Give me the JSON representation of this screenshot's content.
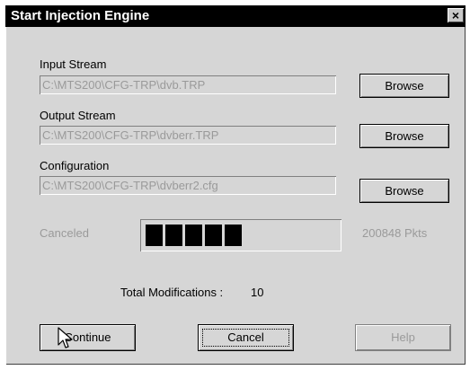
{
  "window": {
    "title": "Start Injection Engine",
    "close_glyph": "×"
  },
  "input_stream": {
    "label": "Input Stream",
    "value": "C:\\MTS200\\CFG-TRP\\dvb.TRP",
    "browse_label": "Browse"
  },
  "output_stream": {
    "label": "Output Stream",
    "value": "C:\\MTS200\\CFG-TRP\\dvberr.TRP",
    "browse_label": "Browse"
  },
  "configuration": {
    "label": "Configuration",
    "value": "C:\\MTS200\\CFG-TRP\\dvberr2.cfg",
    "browse_label": "Browse"
  },
  "status": {
    "state_text": "Canceled",
    "packets_text": "200848 Pkts",
    "progress_blocks_filled": 5
  },
  "summary": {
    "label": "Total Modifications :",
    "value": "10"
  },
  "buttons": {
    "continue_label": "Continue",
    "cancel_label": "Cancel",
    "help_label": "Help"
  },
  "colors": {
    "titlebar": "#000000",
    "dialog_bg": "#d6d6d6",
    "disabled_text": "#9a9a9a",
    "progress_fill": "#000000"
  }
}
